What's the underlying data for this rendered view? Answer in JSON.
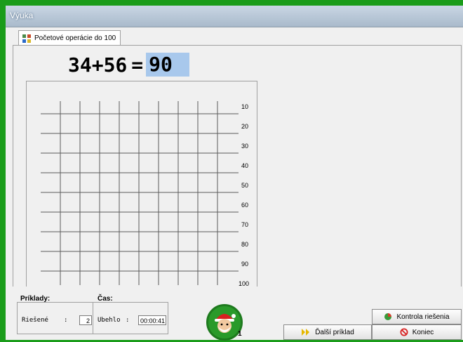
{
  "window": {
    "title": "Výuka"
  },
  "tab": {
    "label": "Početové operácie do 100"
  },
  "exercise": {
    "operand1": "34",
    "operator": "+",
    "operand2": "56",
    "equals": "=",
    "answer": "90"
  },
  "grid": {
    "tick_labels": [
      "10",
      "20",
      "30",
      "40",
      "50",
      "60",
      "70",
      "80",
      "90",
      "100"
    ]
  },
  "examples": {
    "title": "Príklady:",
    "solved_label": "Riešené",
    "separator": ":",
    "solved_value": "2"
  },
  "time": {
    "title": "Čas:",
    "elapsed_label": "Ubehlo",
    "separator": ":",
    "elapsed_value": "00:00:41"
  },
  "mascot": {
    "icon": "santa-icon",
    "count": "1"
  },
  "buttons": {
    "check": "Kontrola riešenia",
    "next": "Ďalší príklad",
    "end": "Koniec"
  },
  "colors": {
    "background": "#1a9c1a",
    "answer_highlight": "#a8c8ec"
  }
}
